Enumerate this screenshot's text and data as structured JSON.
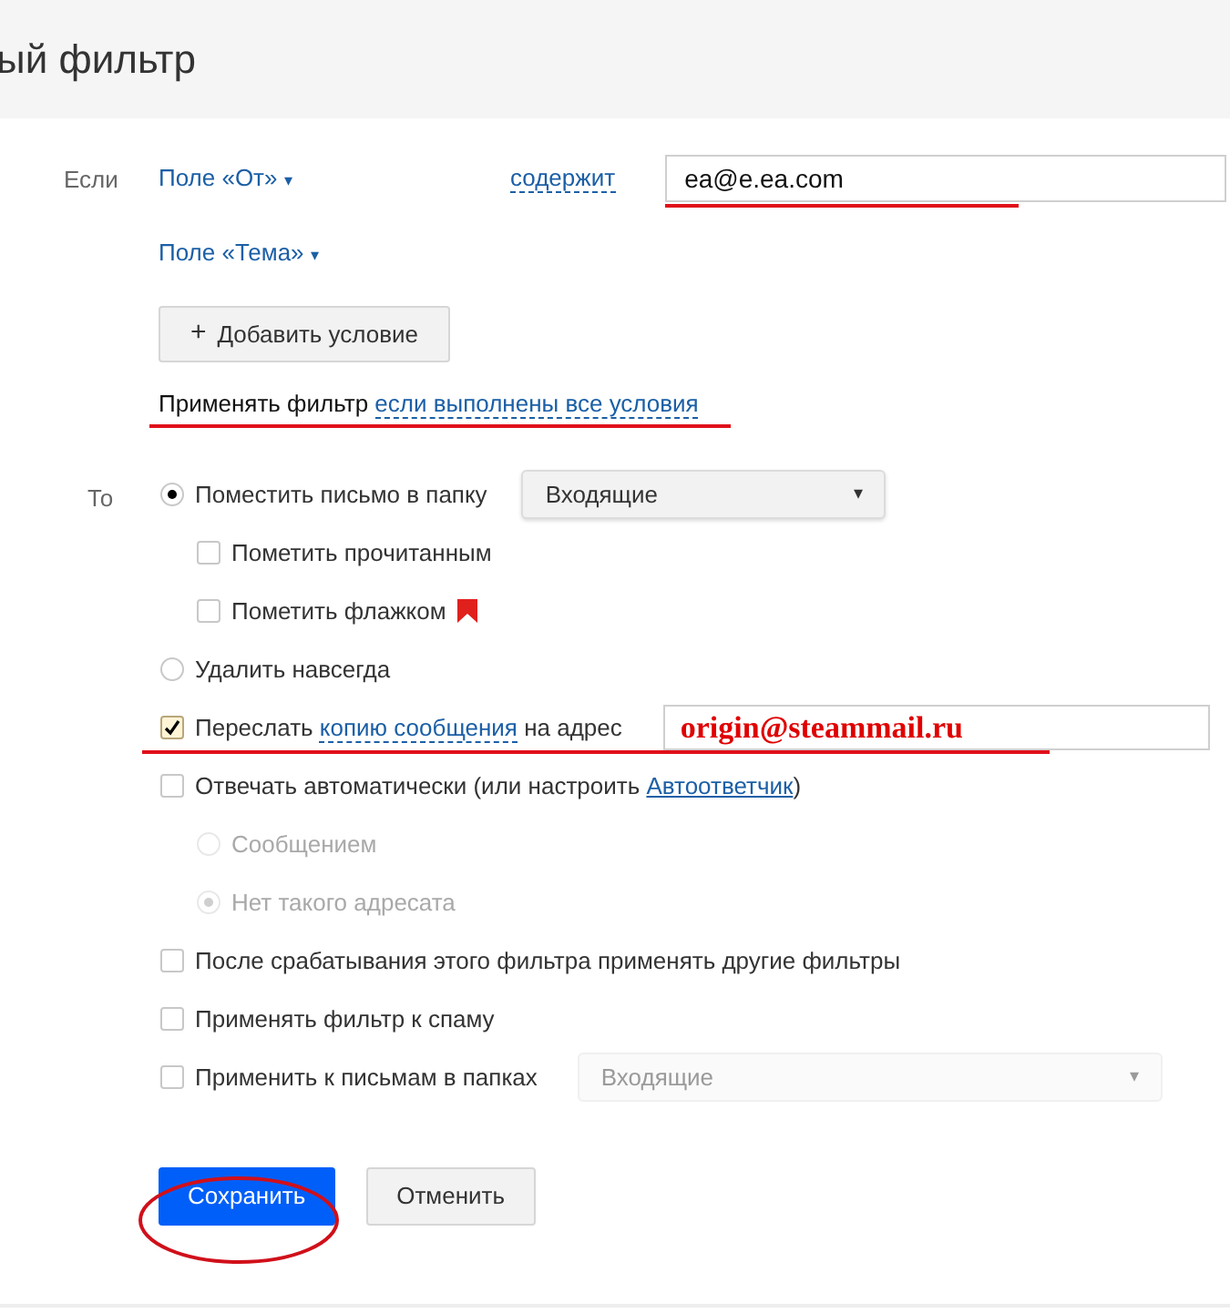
{
  "header": {
    "title": "ый фильтр"
  },
  "conditions": {
    "label": "Если",
    "rows": [
      {
        "field": "Поле «От»",
        "caret": "▾",
        "operator": "содержит",
        "value": "ea@e.ea.com"
      },
      {
        "field": "Поле «Тема»",
        "caret": "▾"
      }
    ],
    "add_button": {
      "icon": "+",
      "label": "Добавить условие"
    },
    "apply_text": "Применять фильтр",
    "apply_link": "если выполнены все условия"
  },
  "actions": {
    "label": "То",
    "items": [
      {
        "kind": "radio",
        "selected": true,
        "disabled": false,
        "parts": [
          {
            "kind": "text",
            "text": "Поместить письмо в папку"
          }
        ],
        "select": {
          "value": "Входящие",
          "caret": "▾",
          "disabled": false
        },
        "children": [
          {
            "kind": "checkbox",
            "checked": false,
            "disabled": false,
            "parts": [
              {
                "kind": "text",
                "text": "Пометить прочитанным"
              }
            ]
          },
          {
            "kind": "checkbox",
            "checked": false,
            "disabled": false,
            "flag": true,
            "parts": [
              {
                "kind": "text",
                "text": "Пометить флажком"
              }
            ]
          }
        ]
      },
      {
        "kind": "radio",
        "selected": false,
        "disabled": false,
        "parts": [
          {
            "kind": "text",
            "text": "Удалить навсегда"
          }
        ]
      },
      {
        "kind": "checkbox",
        "checked": true,
        "disabled": false,
        "parts": [
          {
            "kind": "text",
            "text": "Переслать"
          },
          {
            "kind": "link",
            "text": "копию сообщения"
          },
          {
            "kind": "text",
            "text": "на адрес"
          }
        ],
        "input": "origin@steammail.ru"
      },
      {
        "kind": "checkbox",
        "checked": false,
        "disabled": false,
        "parts": [
          {
            "kind": "text",
            "text": "Отвечать автоматически (или настроить"
          },
          {
            "kind": "underlined",
            "text": "Автоответчик"
          },
          {
            "kind": "text",
            "text": ")"
          }
        ],
        "children": [
          {
            "kind": "radio",
            "selected": false,
            "disabled": true,
            "parts": [
              {
                "kind": "text",
                "text": "Сообщением"
              }
            ]
          },
          {
            "kind": "radio",
            "selected": true,
            "disabled": true,
            "parts": [
              {
                "kind": "text",
                "text": "Нет такого адресата"
              }
            ]
          }
        ]
      },
      {
        "kind": "checkbox",
        "checked": false,
        "disabled": false,
        "parts": [
          {
            "kind": "text",
            "text": "После срабатывания этого фильтра применять другие фильтры"
          }
        ]
      },
      {
        "kind": "checkbox",
        "checked": false,
        "disabled": false,
        "parts": [
          {
            "kind": "text",
            "text": "Применять фильтр к спаму"
          }
        ]
      },
      {
        "kind": "checkbox",
        "checked": false,
        "disabled": false,
        "parts": [
          {
            "kind": "text",
            "text": "Применить к письмам в папках"
          }
        ],
        "select": {
          "value": "Входящие",
          "caret": "▾",
          "disabled": true
        }
      }
    ]
  },
  "buttons": [
    {
      "kind": "primary",
      "label": "Сохранить"
    },
    {
      "kind": "secondary",
      "label": "Отменить"
    }
  ]
}
